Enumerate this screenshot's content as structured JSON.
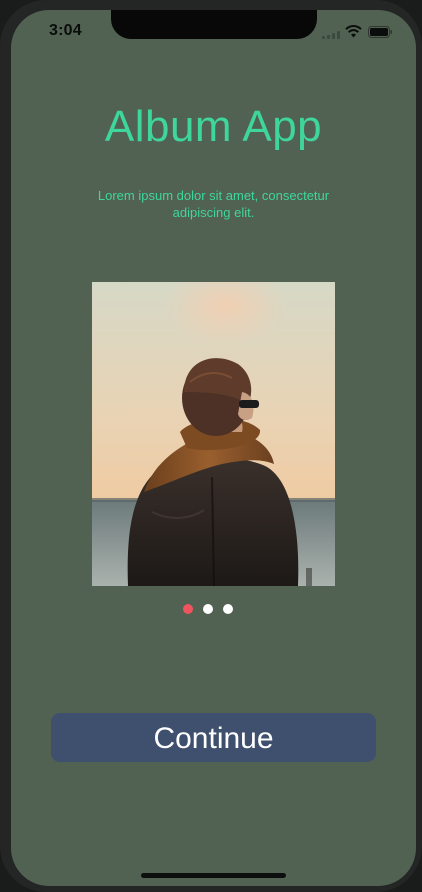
{
  "status_bar": {
    "time": "3:04"
  },
  "header": {
    "title": "Album App",
    "subtitle": "Lorem ipsum dolor sit amet, consectetur adipiscing elit."
  },
  "carousel": {
    "image_description": "person-wearing-scarf-at-sea",
    "pages": 3,
    "active_index": 0,
    "active_color": "#f0545f",
    "inactive_color": "#ffffff"
  },
  "actions": {
    "continue_label": "Continue"
  },
  "colors": {
    "background": "#516252",
    "accent": "#3ed69a",
    "button": "#3f506e"
  }
}
